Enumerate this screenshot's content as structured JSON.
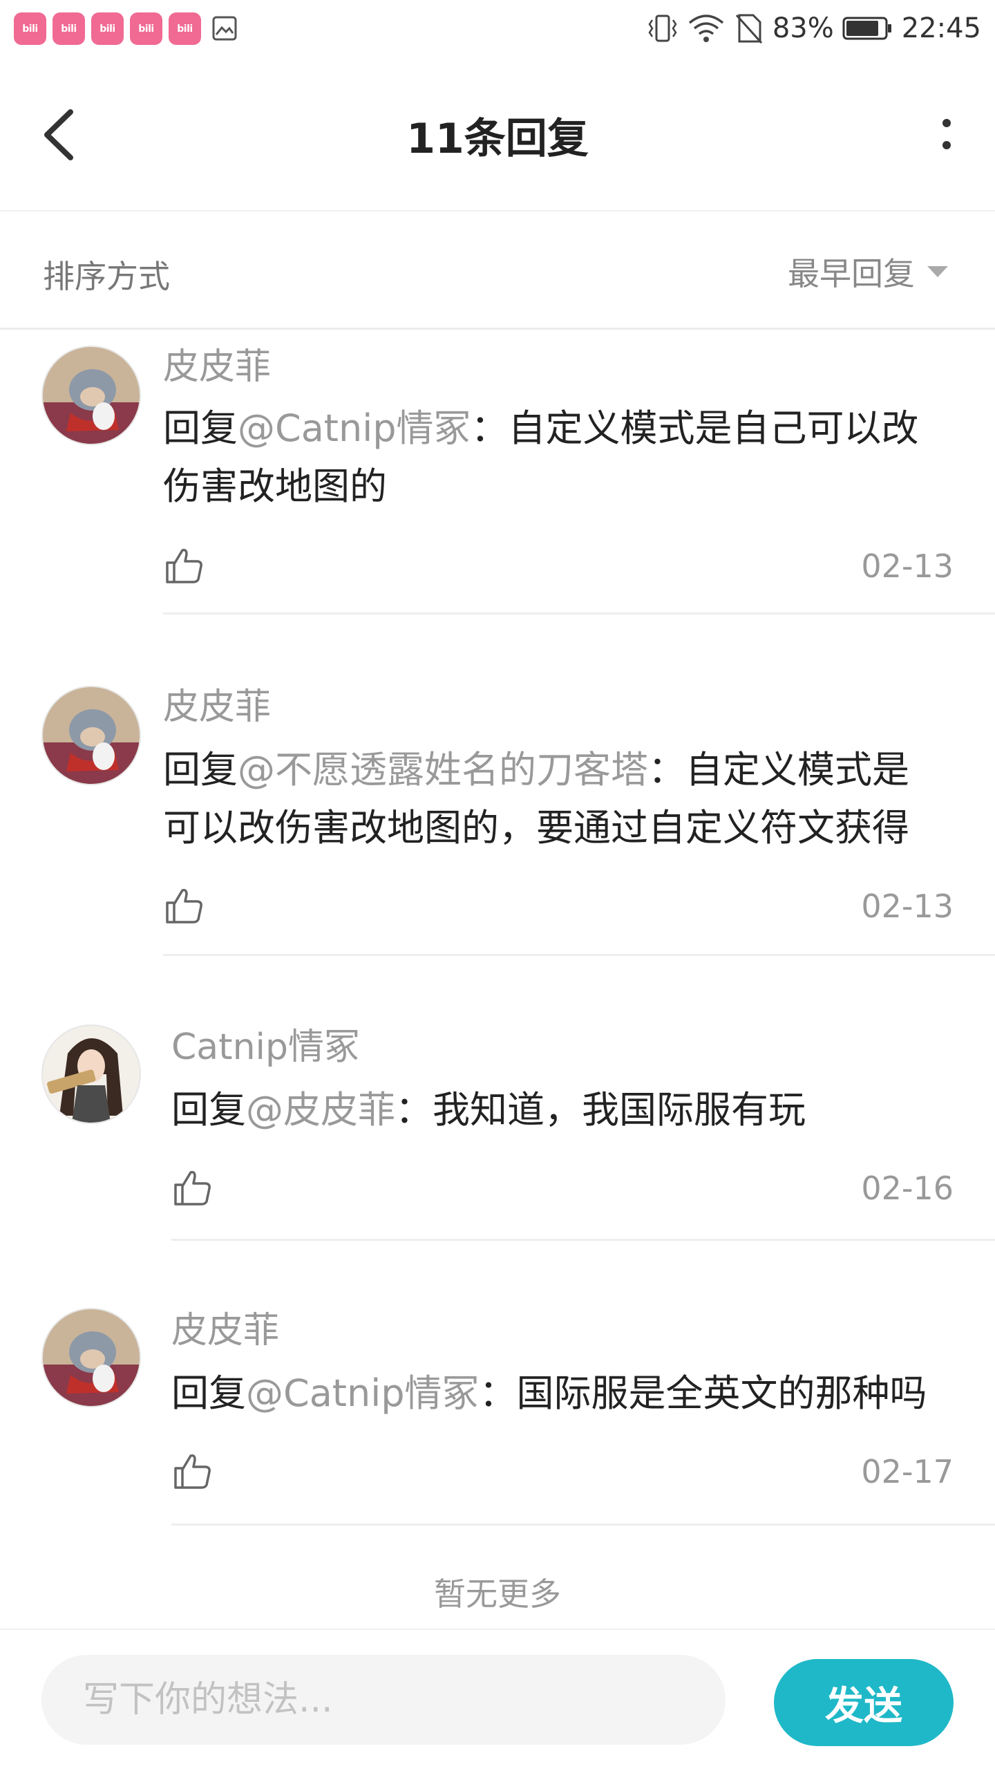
{
  "status_bar": {
    "app_icons": [
      "bilibili",
      "bilibili",
      "bilibili",
      "bilibili",
      "bilibili"
    ],
    "battery": "83%",
    "time": "22:45"
  },
  "header": {
    "title": "11条回复"
  },
  "sort": {
    "label": "排序方式",
    "selected": "最早回复"
  },
  "replies": [
    {
      "username": "皮皮菲",
      "prefix": "回复",
      "mention": "@Catnip情冢",
      "text": "：自定义模式是自己可以改伤害改地图的",
      "date": "02-13"
    },
    {
      "username": "皮皮菲",
      "prefix": "回复",
      "mention": "@不愿透露姓名的刀客塔",
      "text": "：自定义模式是可以改伤害改地图的，要通过自定义符文获得",
      "date": "02-13"
    },
    {
      "username": "Catnip情冢",
      "prefix": "回复",
      "mention": "@皮皮菲",
      "text": "：我知道，我国际服有玩",
      "date": "02-16"
    },
    {
      "username": "皮皮菲",
      "prefix": "回复",
      "mention": "@Catnip情冢",
      "text": "：国际服是全英文的那种吗",
      "date": "02-17"
    }
  ],
  "footer_note": "暂无更多",
  "composer": {
    "placeholder": "写下你的想法...",
    "send_label": "发送"
  },
  "colors": {
    "accent": "#1fb8c8",
    "bili_pink": "#f06a93"
  }
}
